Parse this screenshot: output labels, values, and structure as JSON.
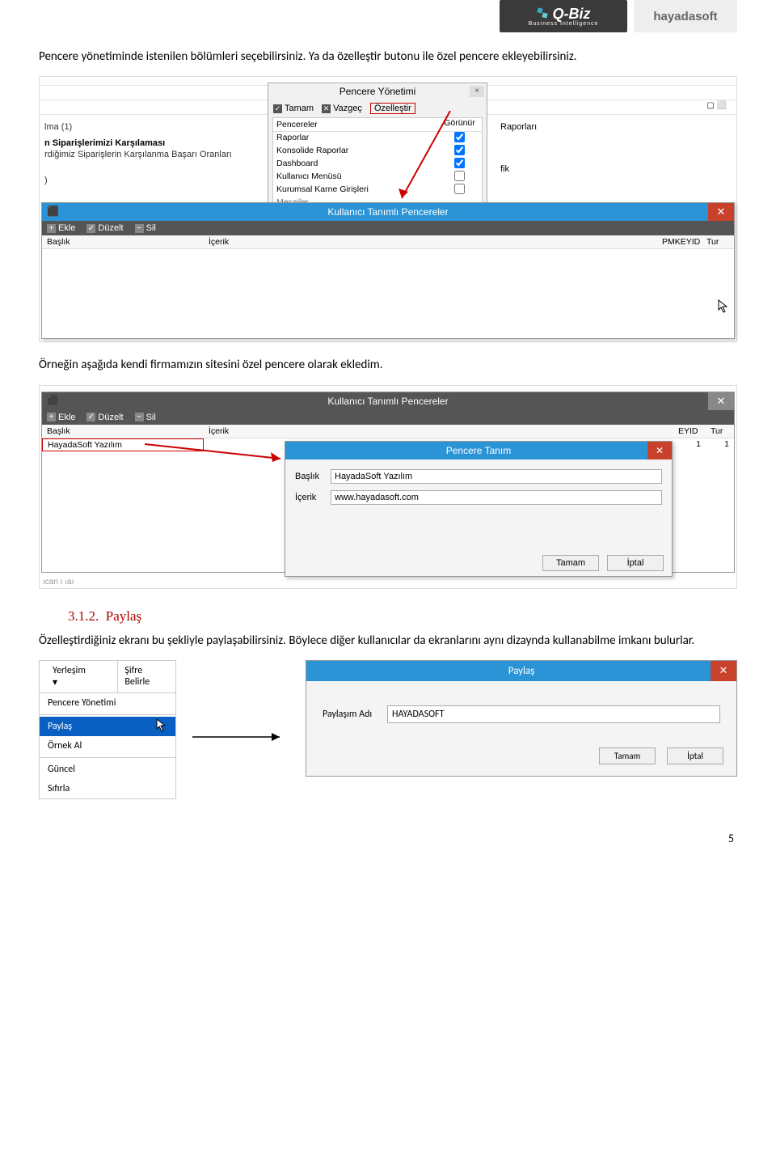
{
  "logos": {
    "qbiz": "Q-Biz",
    "qbiz_sub": "Business Intelligence",
    "hayada": "hayadasoft"
  },
  "p1": "Pencere yönetiminde istenilen bölümleri seçebilirsiniz. Ya da özelleştir butonu ile özel pencere ekleyebilirsiniz.",
  "shot1": {
    "left_lines": {
      "a": "lma (1)",
      "b": "n Siparişlerimizi Karşılaması",
      "c": "rdiğimiz Siparişlerin Karşılanma Başarı Oranları",
      "d": ")",
      "raporlari": "Raporları",
      "fik": "fik"
    },
    "py": {
      "title": "Pencere Yönetimi",
      "tamam": "Tamam",
      "vazgec": "Vazgeç",
      "ozellestir": "Özelleştir",
      "col_pencereler": "Pencereler",
      "col_gorunur": "Görünür",
      "rows": [
        {
          "name": "Raporlar",
          "checked": true
        },
        {
          "name": "Konsolide Raporlar",
          "checked": true
        },
        {
          "name": "Dashboard",
          "checked": true
        },
        {
          "name": "Kullanıcı Menüsü",
          "checked": false
        },
        {
          "name": "Kurumsal Karne Girişleri",
          "checked": false
        },
        {
          "name": "Mesailer",
          "checked": false
        }
      ]
    },
    "ktp": {
      "title": "Kullanıcı Tanımlı Pencereler",
      "ekle": "Ekle",
      "duzelt": "Düzelt",
      "sil": "Sil",
      "col_baslik": "Başlık",
      "col_icerik": "İçerik",
      "col_pmkeyid": "PMKEYID",
      "col_tur": "Tur"
    }
  },
  "p2": "Örneğin aşağıda kendi firmamızın sitesini özel pencere olarak ekledim.",
  "shot2": {
    "ktp": {
      "title": "Kullanıcı Tanımlı Pencereler",
      "ekle": "Ekle",
      "duzelt": "Düzelt",
      "sil": "Sil",
      "col_baslik": "Başlık",
      "col_icerik": "İçerik",
      "col_eyid": "EYID",
      "col_tur": "Tur",
      "row_title": "HayadaSoft Yazılım",
      "row_eyid": "1",
      "row_tur": "1"
    },
    "pt": {
      "title": "Pencere Tanım",
      "lbl_baslik": "Başlık",
      "val_baslik": "HayadaSoft Yazılım",
      "lbl_icerik": "İçerik",
      "val_icerik": "www.hayadasoft.com",
      "tamam": "Tamam",
      "iptal": "İptal"
    },
    "ican": "ıcan ı ıaı"
  },
  "section": {
    "num": "3.1.2.",
    "title": "Paylaş"
  },
  "p3": "Özelleştirdiğiniz ekranı bu şekliyle paylaşabilirsiniz. Böylece diğer kullanıcılar da ekranlarını aynı dizaynda kullanabilme imkanı bulurlar.",
  "shot3": {
    "menu": {
      "yerlesim": "Yerleşim",
      "sifre": "Şifre Belirle",
      "pencere": "Pencere Yönetimi",
      "paylas": "Paylaş",
      "ornek": "Örnek Al",
      "guncel": "Güncel",
      "sifirla": "Sıfırla"
    },
    "dlg": {
      "title": "Paylaş",
      "lbl": "Paylaşım Adı",
      "val": "HAYADASOFT",
      "tamam": "Tamam",
      "iptal": "İptal"
    }
  },
  "page": "5"
}
